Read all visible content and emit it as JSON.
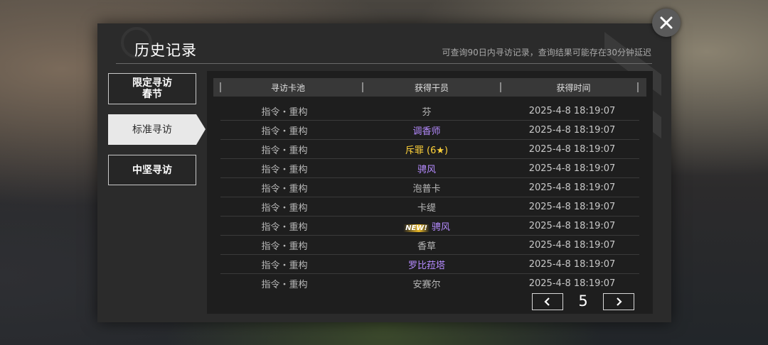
{
  "header": {
    "title": "历史记录",
    "subtitle": "可查询90日内寻访记录，查询结果可能存在30分钟延迟"
  },
  "sidebar": {
    "items": [
      {
        "label": "限定寻访\n春节",
        "selected": false
      },
      {
        "label": "标准寻访",
        "selected": true
      },
      {
        "label": "中坚寻访",
        "selected": false
      }
    ]
  },
  "table": {
    "headers": [
      "寻访卡池",
      "获得干员",
      "获得时间"
    ],
    "rows": [
      {
        "pool": "指令・重构",
        "operator": "芬",
        "time": "2025-4-8 18:19:07",
        "rarity": "normal",
        "new": false
      },
      {
        "pool": "指令・重构",
        "operator": "调香师",
        "time": "2025-4-8 18:19:07",
        "rarity": "purple",
        "new": false
      },
      {
        "pool": "指令・重构",
        "operator": "斥罪 (6★)",
        "time": "2025-4-8 18:19:07",
        "rarity": "gold",
        "new": false
      },
      {
        "pool": "指令・重构",
        "operator": "骋风",
        "time": "2025-4-8 18:19:07",
        "rarity": "purple",
        "new": false
      },
      {
        "pool": "指令・重构",
        "operator": "泡普卡",
        "time": "2025-4-8 18:19:07",
        "rarity": "normal",
        "new": false
      },
      {
        "pool": "指令・重构",
        "operator": "卡缇",
        "time": "2025-4-8 18:19:07",
        "rarity": "normal",
        "new": false
      },
      {
        "pool": "指令・重构",
        "operator": "骋风",
        "time": "2025-4-8 18:19:07",
        "rarity": "purple",
        "new": true
      },
      {
        "pool": "指令・重构",
        "operator": "香草",
        "time": "2025-4-8 18:19:07",
        "rarity": "normal",
        "new": false
      },
      {
        "pool": "指令・重构",
        "operator": "罗比菈塔",
        "time": "2025-4-8 18:19:07",
        "rarity": "purple",
        "new": false
      },
      {
        "pool": "指令・重构",
        "operator": "安赛尔",
        "time": "2025-4-8 18:19:07",
        "rarity": "normal",
        "new": false
      }
    ],
    "new_tag": "NEW!"
  },
  "pager": {
    "page": "5",
    "prev_icon": "chevron-left-icon",
    "next_icon": "chevron-right-icon"
  },
  "colors": {
    "purple": "#b58bff",
    "gold": "#ffd23a",
    "panel": "#2b2b2b"
  },
  "icons": {
    "close": "close-icon"
  }
}
